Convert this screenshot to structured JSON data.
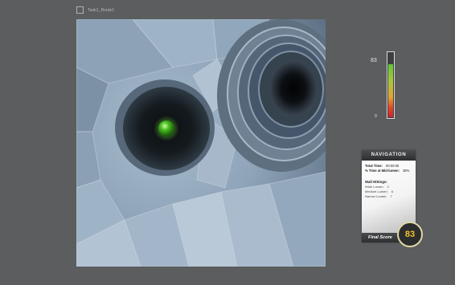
{
  "task": {
    "label": "Task1_Route1"
  },
  "game": {
    "target_icon": "green-ball-icon"
  },
  "gauge": {
    "value_label": "83",
    "min_label": "0",
    "level_fraction": 0.83,
    "colors": {
      "top": "#62c43b",
      "bottom": "#c9252a"
    }
  },
  "navigation": {
    "title": "NAVIGATION",
    "total_time_label": "Total Time:",
    "total_time_value": "00:00:00",
    "mid_lumen_label": "% Time at Mid-lumen:",
    "mid_lumen_value": "39%",
    "wall_hittings_label": "Wall Hittings:",
    "wide_lumen_label": "Wide Lumen:",
    "wide_lumen_value": "2",
    "medium_lumen_label": "Medium Lumen:",
    "medium_lumen_value": "6",
    "narrow_lumen_label": "Narrow Lumen:",
    "narrow_lumen_value": "7",
    "final_score_label": "Final Score",
    "final_score_value": "83"
  },
  "colors": {
    "background": "#5b5d5f",
    "score_text": "#f2c02e",
    "target": "#5bd12e"
  }
}
